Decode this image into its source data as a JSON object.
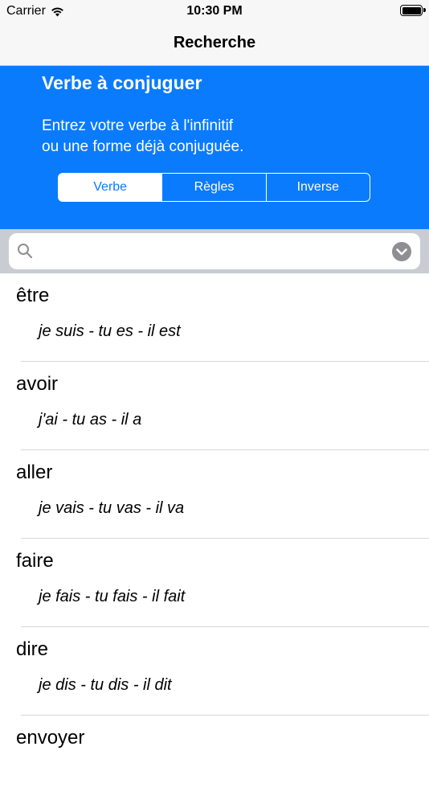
{
  "status_bar": {
    "carrier": "Carrier",
    "time": "10:30 PM"
  },
  "nav": {
    "title": "Recherche"
  },
  "header": {
    "title": "Verbe à conjuguer",
    "description_line1": "Entrez votre verbe à l'infinitif",
    "description_line2": "ou une forme déjà conjuguée.",
    "accent_color": "#0a7bfd"
  },
  "tabs": [
    {
      "label": "Verbe",
      "selected": true
    },
    {
      "label": "Règles",
      "selected": false
    },
    {
      "label": "Inverse",
      "selected": false
    }
  ],
  "search": {
    "value": "",
    "placeholder": ""
  },
  "verbs": [
    {
      "infinitive": "être",
      "forms": "je suis - tu es - il est"
    },
    {
      "infinitive": "avoir",
      "forms": "j'ai - tu as - il a"
    },
    {
      "infinitive": "aller",
      "forms": "je vais - tu vas - il va"
    },
    {
      "infinitive": "faire",
      "forms": "je fais - tu fais - il fait"
    },
    {
      "infinitive": "dire",
      "forms": "je dis - tu dis - il dit"
    },
    {
      "infinitive": "envoyer",
      "forms": ""
    }
  ]
}
